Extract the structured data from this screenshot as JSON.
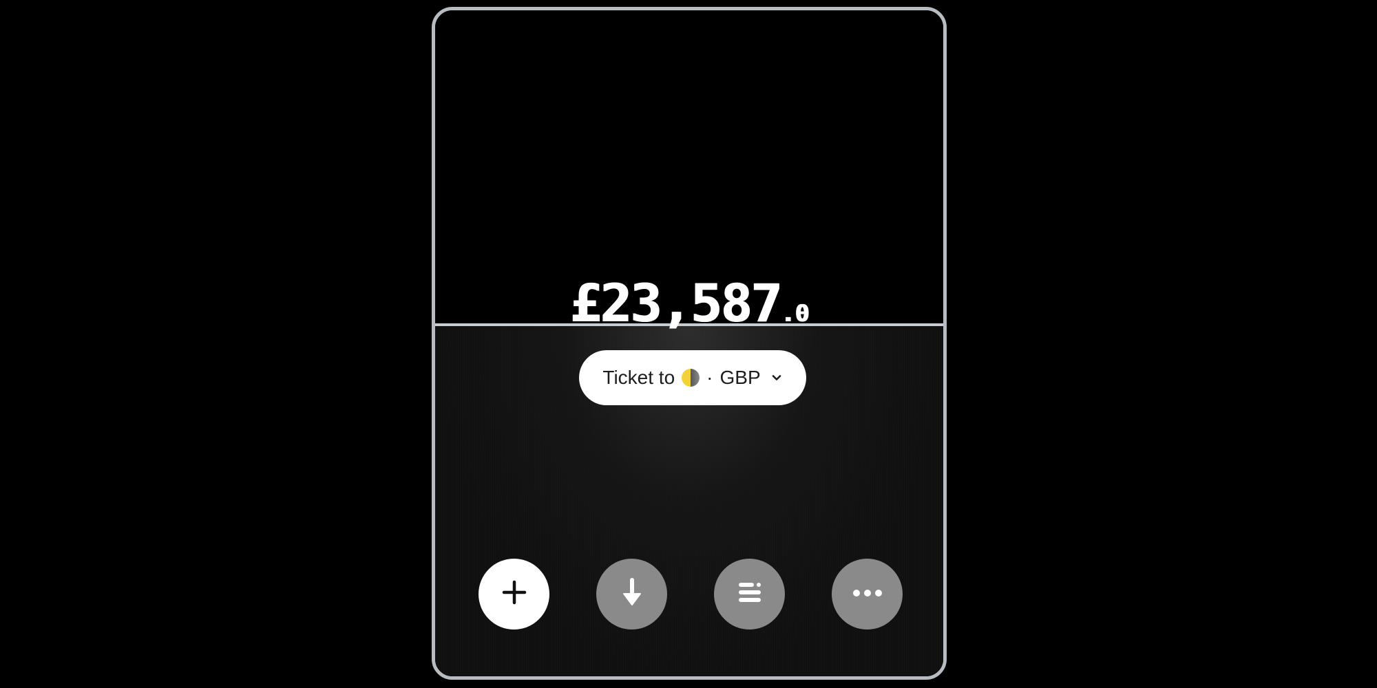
{
  "balance": {
    "integer": "£23,587",
    "decimal": ".0"
  },
  "account_selector": {
    "label": "Ticket to",
    "separator": "·",
    "currency": "GBP",
    "icon": "moon-phase-icon"
  },
  "actions": [
    {
      "name": "add",
      "icon": "plus-icon"
    },
    {
      "name": "receive",
      "icon": "arrow-down-icon"
    },
    {
      "name": "details",
      "icon": "list-details-icon"
    },
    {
      "name": "more",
      "icon": "more-dots-icon"
    }
  ],
  "colors": {
    "background": "#000000",
    "card_border": "#b7bcc3",
    "primary_button": "#ffffff",
    "secondary_button": "#8a8a8a",
    "moon_lit": "#f1d23b"
  }
}
